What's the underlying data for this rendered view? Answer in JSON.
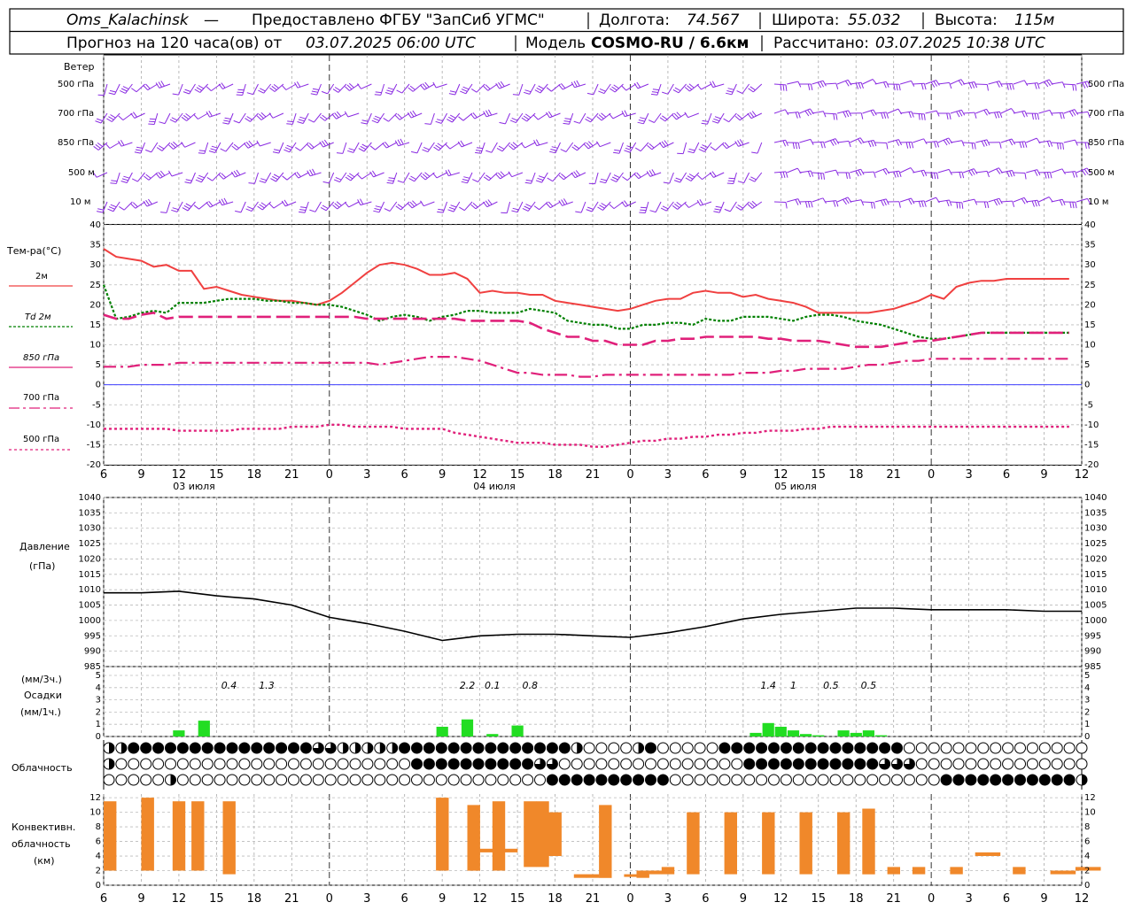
{
  "header": {
    "station": "Oms_Kalachinsk",
    "dash": "—",
    "provider": "Предоставлено ФГБУ \"ЗапСиб УГМС\"",
    "lon_label": "Долгота:",
    "lon_value": "74.567",
    "lat_label": "Широта:",
    "lat_value": "55.032",
    "alt_label": "Высота:",
    "alt_value": "115м",
    "forecast_prefix": "Прогноз на 120 часа(ов) от",
    "forecast_time": "03.07.2025 06:00 UTC",
    "model_label": "Модель",
    "model_value": "COSMO-RU / 6.6км",
    "computed_label": "Рассчитано:",
    "computed_time": "03.07.2025 10:38 UTC"
  },
  "x_ticks": [
    "6",
    "9",
    "12",
    "15",
    "18",
    "21",
    "0",
    "3",
    "6",
    "9",
    "12",
    "15",
    "18",
    "21",
    "0",
    "3",
    "6",
    "9",
    "12",
    "15",
    "18",
    "21",
    "0",
    "3",
    "6",
    "9",
    "12"
  ],
  "dates": [
    "03 июля",
    "04 июля",
    "05 июля"
  ],
  "wind": {
    "title": "Ветер",
    "levels": [
      "500 гПа",
      "700 гПа",
      "850 гПа",
      "500 м",
      "10  м"
    ]
  },
  "temp_panel": {
    "title": "Тем-ра(°С)",
    "legend": [
      "2м",
      "Td  2м",
      "850 гПа",
      "700 гПа",
      "500 гПа"
    ],
    "y_ticks": [
      "40",
      "35",
      "30",
      "25",
      "20",
      "15",
      "10",
      "5",
      "0",
      "-5",
      "-10",
      "-15",
      "-20"
    ]
  },
  "pressure_panel": {
    "title": "Давление",
    "unit": "(гПа)",
    "y_ticks": [
      "1040",
      "1035",
      "1030",
      "1025",
      "1020",
      "1015",
      "1010",
      "1005",
      "1000",
      "995",
      "990",
      "985"
    ]
  },
  "precip_panel": {
    "unit3": "(мм/3ч.)",
    "title": "Осадки",
    "unit1": "(мм/1ч.)",
    "y_ticks": [
      "5",
      "4",
      "3",
      "2",
      "1",
      "0"
    ],
    "labels": [
      {
        "hour": 10,
        "text": "0.4"
      },
      {
        "hour": 13,
        "text": "1.3"
      },
      {
        "hour": 29,
        "text": "2.2"
      },
      {
        "hour": 31,
        "text": "0.1"
      },
      {
        "hour": 34,
        "text": "0.8"
      },
      {
        "hour": 53,
        "text": "1.4"
      },
      {
        "hour": 55,
        "text": "1"
      },
      {
        "hour": 58,
        "text": "0.5"
      },
      {
        "hour": 61,
        "text": "0.5"
      }
    ]
  },
  "cloud_panel": {
    "title": "Облачность"
  },
  "conv_panel": {
    "title1": "Конвективн.",
    "title2": "облачность",
    "unit": "(км)",
    "y_ticks": [
      "12",
      "10",
      "8",
      "6",
      "4",
      "2",
      "0"
    ]
  },
  "colors": {
    "t2m": "#f04040",
    "td2m": "#008000",
    "t850": "#e0207a",
    "t700": "#e0207a",
    "t500": "#e0207a",
    "wind": "#8a2be2",
    "zero": "#4040ff",
    "precip": "#22dd22",
    "conv": "#f0882a",
    "pressure": "#000000"
  },
  "chart_data": [
    {
      "type": "line",
      "title": "Тем-ра(°С)",
      "x_hours_from_start": [
        0,
        1,
        2,
        3,
        4,
        5,
        6,
        7,
        8,
        9,
        10,
        11,
        12,
        13,
        14,
        15,
        16,
        17,
        18,
        19,
        20,
        21,
        22,
        23,
        24,
        25,
        26,
        27,
        28,
        29,
        30,
        31,
        32,
        33,
        34,
        35,
        36,
        37,
        38,
        39,
        40,
        41,
        42,
        43,
        44,
        45,
        46,
        47,
        48,
        49,
        50,
        51,
        52,
        53,
        54,
        55,
        56,
        57,
        58,
        59,
        60,
        61,
        62,
        63,
        64,
        65,
        66,
        67,
        68,
        69,
        70,
        71,
        72,
        73,
        74,
        75,
        76,
        77
      ],
      "ylim": [
        -20,
        40
      ],
      "series": [
        {
          "name": "2м",
          "values": [
            34,
            32,
            31.5,
            31,
            29.5,
            30,
            28.5,
            28.5,
            24,
            24.5,
            23.5,
            22.5,
            22,
            21.5,
            21,
            21,
            20.5,
            20,
            21,
            23,
            25.5,
            28,
            30,
            30.5,
            30,
            29,
            27.5,
            27.5,
            28,
            26.5,
            23,
            23.5,
            23,
            23,
            22.5,
            22.5,
            21,
            20.5,
            20,
            19.5,
            19,
            18.5,
            19,
            20,
            21,
            21.5,
            21.5,
            23,
            23.5,
            23,
            23,
            22,
            22.5,
            21.5,
            21,
            20.5,
            19.5,
            18,
            18,
            18,
            18,
            18,
            18.5,
            19,
            20,
            21,
            22.5,
            21.5,
            24.5,
            25.5,
            26,
            26,
            26.5,
            26.5,
            26.5,
            26.5,
            26.5,
            26.5
          ]
        },
        {
          "name": "Td  2м",
          "values": [
            25,
            16.5,
            17,
            18,
            18.5,
            18,
            20.5,
            20.5,
            20.5,
            21,
            21.5,
            21.5,
            21.5,
            21,
            21,
            20.5,
            20.5,
            20,
            20,
            19.5,
            18.5,
            17.5,
            16,
            17,
            17.5,
            17,
            16,
            17,
            17.5,
            18.5,
            18.5,
            18,
            18,
            18,
            19,
            18.5,
            18,
            16,
            15.5,
            15,
            15,
            14,
            14,
            15,
            15,
            15.5,
            15.5,
            15,
            16.5,
            16,
            16,
            17,
            17,
            17,
            16.5,
            16,
            17,
            17.5,
            17.5,
            17,
            16,
            15.5,
            15,
            14,
            13,
            12,
            11.5,
            11.5,
            12,
            12.5,
            13,
            13,
            13,
            13,
            13,
            13,
            13,
            13
          ]
        },
        {
          "name": "850 гПа",
          "values": [
            17.5,
            16.5,
            16.5,
            17.5,
            18,
            16.5,
            17,
            17,
            17,
            17,
            17,
            17,
            17,
            17,
            17,
            17,
            17,
            17,
            17,
            17,
            17,
            16.5,
            16.5,
            16.5,
            16.5,
            16.5,
            16.5,
            16.5,
            16.5,
            16,
            16,
            16,
            16,
            16,
            15.5,
            14,
            13,
            12,
            12,
            11,
            11,
            10,
            10,
            10,
            11,
            11,
            11.5,
            11.5,
            12,
            12,
            12,
            12,
            12,
            11.5,
            11.5,
            11,
            11,
            11,
            10.5,
            10,
            9.5,
            9.5,
            9.5,
            10,
            10.5,
            11,
            11,
            11.5,
            12,
            12.5,
            13,
            13,
            13,
            13,
            13,
            13,
            13,
            13
          ]
        },
        {
          "name": "700 гПа",
          "values": [
            4.5,
            4.5,
            4.5,
            5,
            5,
            5,
            5.5,
            5.5,
            5.5,
            5.5,
            5.5,
            5.5,
            5.5,
            5.5,
            5.5,
            5.5,
            5.5,
            5.5,
            5.5,
            5.5,
            5.5,
            5.5,
            5,
            5.5,
            6,
            6.5,
            7,
            7,
            7,
            6.5,
            6,
            5,
            4,
            3,
            3,
            2.5,
            2.5,
            2.5,
            2,
            2,
            2.5,
            2.5,
            2.5,
            2.5,
            2.5,
            2.5,
            2.5,
            2.5,
            2.5,
            2.5,
            2.5,
            3,
            3,
            3,
            3.5,
            3.5,
            4,
            4,
            4,
            4,
            4.5,
            5,
            5,
            5.5,
            6,
            6,
            6.5,
            6.5,
            6.5,
            6.5,
            6.5,
            6.5,
            6.5,
            6.5,
            6.5,
            6.5,
            6.5,
            6.5
          ]
        },
        {
          "name": "500 гПа",
          "values": [
            -11,
            -11,
            -11,
            -11,
            -11,
            -11,
            -11.5,
            -11.5,
            -11.5,
            -11.5,
            -11.5,
            -11,
            -11,
            -11,
            -11,
            -10.5,
            -10.5,
            -10.5,
            -10,
            -10,
            -10.5,
            -10.5,
            -10.5,
            -10.5,
            -11,
            -11,
            -11,
            -11,
            -12,
            -12.5,
            -13,
            -13.5,
            -14,
            -14.5,
            -14.5,
            -14.5,
            -15,
            -15,
            -15,
            -15.5,
            -15.5,
            -15,
            -14.5,
            -14,
            -14,
            -13.5,
            -13.5,
            -13,
            -13,
            -12.5,
            -12.5,
            -12,
            -12,
            -11.5,
            -11.5,
            -11.5,
            -11,
            -11,
            -10.5,
            -10.5,
            -10.5,
            -10.5,
            -10.5,
            -10.5,
            -10.5,
            -10.5,
            -10.5,
            -10.5,
            -10.5,
            -10.5,
            -10.5,
            -10.5,
            -10.5,
            -10.5,
            -10.5,
            -10.5,
            -10.5,
            -10.5
          ]
        }
      ]
    },
    {
      "type": "line",
      "title": "Давление",
      "ylim": [
        985,
        1040
      ],
      "x_hours_from_start": [
        0,
        3,
        6,
        9,
        12,
        15,
        18,
        21,
        24,
        27,
        30,
        33,
        36,
        39,
        42,
        45,
        48,
        51,
        54,
        57,
        60,
        63,
        66,
        69,
        72,
        75,
        78
      ],
      "series": [
        {
          "name": "Давление",
          "values": [
            1009,
            1009,
            1009.5,
            1008,
            1007,
            1005,
            1001,
            999,
            996.5,
            993.5,
            995,
            995.5,
            995.5,
            995,
            994.5,
            996,
            998,
            1000.5,
            1002,
            1003,
            1004,
            1004,
            1003.5,
            1003.5,
            1003.5,
            1003,
            1003
          ]
        }
      ]
    },
    {
      "type": "bar",
      "title": "Осадки",
      "ylim": [
        0,
        5
      ],
      "x_hours_from_start": [
        6,
        8,
        27,
        29,
        31,
        33,
        52,
        53,
        54,
        55,
        56,
        57,
        59,
        60,
        61,
        62
      ],
      "values": [
        0.5,
        1.3,
        0.8,
        1.4,
        0.2,
        0.9,
        0.3,
        1.1,
        0.8,
        0.5,
        0.2,
        0.1,
        0.5,
        0.3,
        0.5,
        0.1
      ]
    },
    {
      "type": "bar",
      "title": "Конвективн. облачность (км)",
      "ylim": [
        0,
        13
      ],
      "bars": [
        {
          "x_hour": 0.5,
          "bottom": 2,
          "top": 11.5
        },
        {
          "x_hour": 3.5,
          "bottom": 2,
          "top": 12
        },
        {
          "x_hour": 6,
          "bottom": 2,
          "top": 11.5
        },
        {
          "x_hour": 7.5,
          "bottom": 2,
          "top": 11.5
        },
        {
          "x_hour": 10,
          "bottom": 1.5,
          "top": 11.5
        },
        {
          "x_hour": 27,
          "bottom": 2,
          "top": 12
        },
        {
          "x_hour": 29.5,
          "bottom": 2,
          "top": 11
        },
        {
          "x_hour": 30.5,
          "bottom": 4.5,
          "top": 5
        },
        {
          "x_hour": 31.5,
          "bottom": 2,
          "top": 11.5
        },
        {
          "x_hour": 32.5,
          "bottom": 4.5,
          "top": 5
        },
        {
          "x_hour": 34,
          "bottom": 2.5,
          "top": 11.5
        },
        {
          "x_hour": 35,
          "bottom": 2.5,
          "top": 11.5
        },
        {
          "x_hour": 36,
          "bottom": 4,
          "top": 10
        },
        {
          "x_hour": 38,
          "bottom": 1,
          "top": 1.5
        },
        {
          "x_hour": 39,
          "bottom": 1,
          "top": 1.5
        },
        {
          "x_hour": 40,
          "bottom": 1,
          "top": 11
        },
        {
          "x_hour": 42,
          "bottom": 1.5,
          "top": 1.5
        },
        {
          "x_hour": 43,
          "bottom": 1,
          "top": 2
        },
        {
          "x_hour": 44,
          "bottom": 1.5,
          "top": 2
        },
        {
          "x_hour": 45,
          "bottom": 1.5,
          "top": 2.5
        },
        {
          "x_hour": 47,
          "bottom": 1.5,
          "top": 10
        },
        {
          "x_hour": 50,
          "bottom": 1.5,
          "top": 10
        },
        {
          "x_hour": 53,
          "bottom": 1.5,
          "top": 10
        },
        {
          "x_hour": 56,
          "bottom": 1.5,
          "top": 10
        },
        {
          "x_hour": 59,
          "bottom": 1.5,
          "top": 10
        },
        {
          "x_hour": 61,
          "bottom": 1.5,
          "top": 10.5
        },
        {
          "x_hour": 63,
          "bottom": 1.5,
          "top": 2.5
        },
        {
          "x_hour": 65,
          "bottom": 1.5,
          "top": 2.5
        },
        {
          "x_hour": 68,
          "bottom": 1.5,
          "top": 2.5
        },
        {
          "x_hour": 70,
          "bottom": 4,
          "top": 4.5
        },
        {
          "x_hour": 71,
          "bottom": 4,
          "top": 4.5
        },
        {
          "x_hour": 73,
          "bottom": 1.5,
          "top": 2.5
        },
        {
          "x_hour": 76,
          "bottom": 1.5,
          "top": 2
        },
        {
          "x_hour": 77,
          "bottom": 1.5,
          "top": 2
        },
        {
          "x_hour": 78,
          "bottom": 2,
          "top": 2.5
        },
        {
          "x_hour": 79,
          "bottom": 2,
          "top": 2.5
        }
      ]
    }
  ]
}
